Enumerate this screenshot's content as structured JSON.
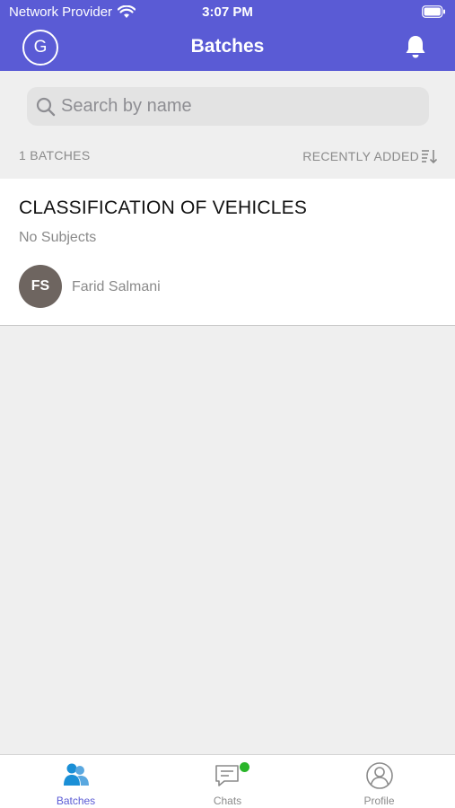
{
  "status_bar": {
    "carrier": "Network Provider",
    "time": "3:07 PM",
    "icons": [
      "wifi-icon",
      "battery-icon"
    ]
  },
  "nav": {
    "avatar_letter": "G",
    "title": "Batches",
    "icons": [
      "bell-icon"
    ]
  },
  "search": {
    "placeholder": "Search by name",
    "value": "",
    "icon": "search-icon"
  },
  "list_meta": {
    "count_label": "1 BATCHES",
    "sort_label": "RECENTLY ADDED",
    "sort_icon": "sort-descending-icon"
  },
  "batches": [
    {
      "title": "CLASSIFICATION OF VEHICLES",
      "subjects": "No Subjects",
      "owner_initials": "FS",
      "owner_name": "Farid Salmani"
    }
  ],
  "tab_bar": {
    "tabs": [
      {
        "label": "Batches",
        "icon": "batches-icon",
        "active": true
      },
      {
        "label": "Chats",
        "icon": "chat-icon",
        "active": false,
        "badge_dot": true
      },
      {
        "label": "Profile",
        "icon": "profile-icon",
        "active": false
      }
    ]
  },
  "colors": {
    "primary": "#5a5bd5",
    "background": "#efefef",
    "owner_avatar": "#6e6560",
    "badge": "#2ab52a",
    "active_tab_icon": "#1a8fd6"
  }
}
